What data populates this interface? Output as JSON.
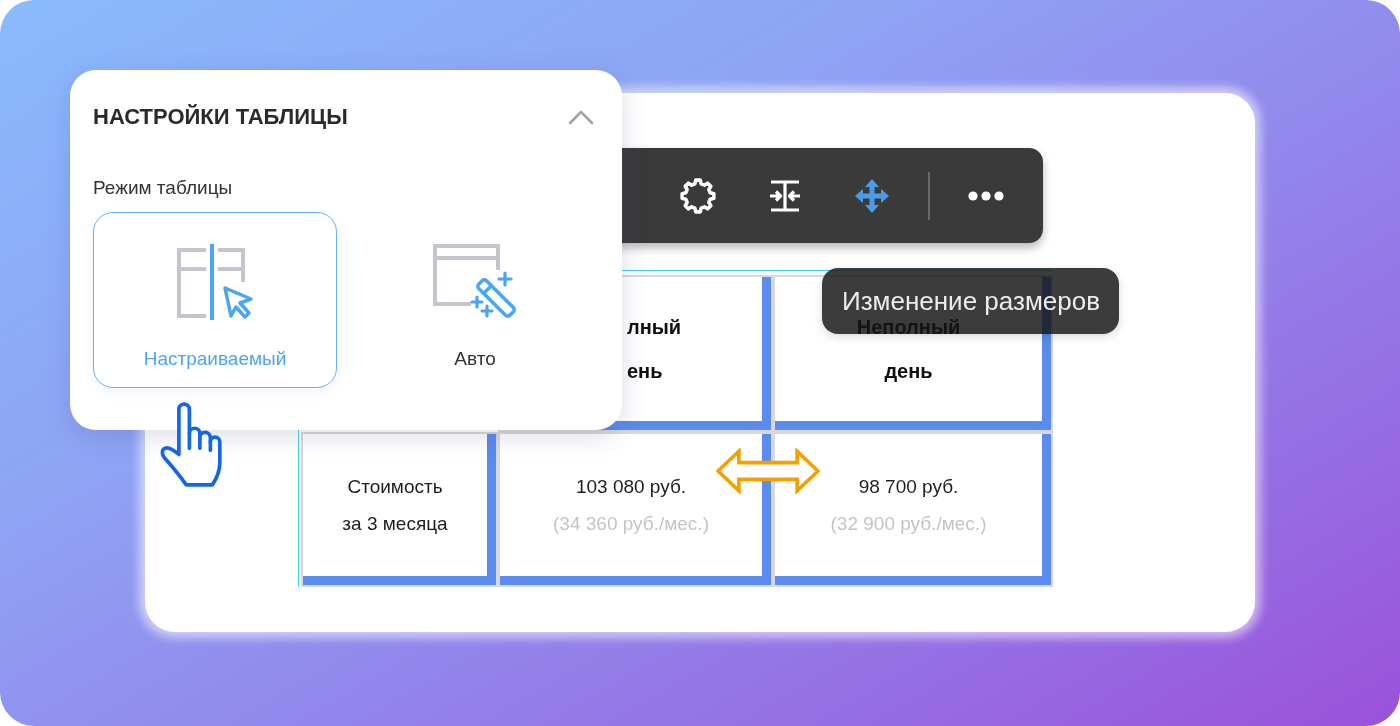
{
  "settings_panel": {
    "title": "НАСТРОЙКИ ТАБЛИЦЫ",
    "expanded": true,
    "section_label": "Режим таблицы",
    "modes": [
      {
        "kind": "custom",
        "label": "Настраиваемый",
        "selected": true
      },
      {
        "kind": "auto",
        "label": "Авто",
        "selected": false
      }
    ]
  },
  "toolbar": {
    "tools": [
      {
        "kind": "settings",
        "selected": false
      },
      {
        "kind": "compress",
        "selected": false
      },
      {
        "kind": "resize",
        "selected": true
      },
      {
        "kind": "more",
        "selected": false
      }
    ]
  },
  "tooltip": {
    "text": "Изменение размеров"
  },
  "table": {
    "rows": [
      {
        "kind": "header",
        "cells": [
          {
            "text": ""
          },
          {
            "text": "лный\nень"
          },
          {
            "text": "Неполный\nдень"
          }
        ]
      },
      {
        "kind": "body",
        "cells": [
          {
            "text": "Стоимость\nза 3 месяца"
          },
          {
            "text": "103 080 руб.",
            "note": "(34 360 руб./мес.)"
          },
          {
            "text": "98 700 руб.",
            "note": "(32 900 руб./мес.)"
          }
        ]
      }
    ]
  }
}
